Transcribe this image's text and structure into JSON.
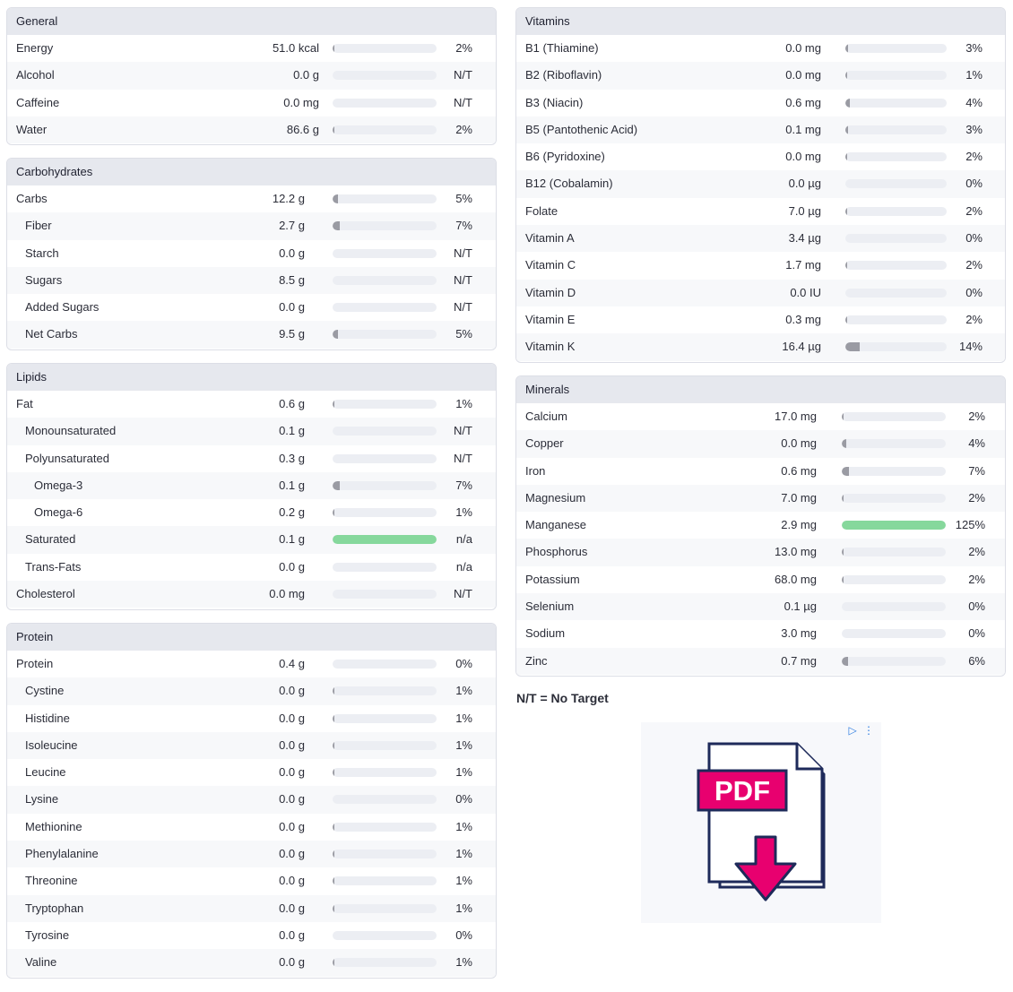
{
  "general": {
    "title": "General",
    "rows": [
      {
        "name": "Energy",
        "amount": "51.0 kcal",
        "pct": "2%",
        "fill": 0.02,
        "indent": 0
      },
      {
        "name": "Alcohol",
        "amount": "0.0 g",
        "pct": "N/T",
        "fill": 0,
        "indent": 0
      },
      {
        "name": "Caffeine",
        "amount": "0.0 mg",
        "pct": "N/T",
        "fill": 0,
        "indent": 0
      },
      {
        "name": "Water",
        "amount": "86.6 g",
        "pct": "2%",
        "fill": 0.02,
        "indent": 0
      }
    ]
  },
  "carbohydrates": {
    "title": "Carbohydrates",
    "rows": [
      {
        "name": "Carbs",
        "amount": "12.2 g",
        "pct": "5%",
        "fill": 0.05,
        "indent": 0
      },
      {
        "name": "Fiber",
        "amount": "2.7 g",
        "pct": "7%",
        "fill": 0.07,
        "indent": 1
      },
      {
        "name": "Starch",
        "amount": "0.0 g",
        "pct": "N/T",
        "fill": 0,
        "indent": 1
      },
      {
        "name": "Sugars",
        "amount": "8.5 g",
        "pct": "N/T",
        "fill": 0,
        "indent": 1
      },
      {
        "name": "Added Sugars",
        "amount": "0.0 g",
        "pct": "N/T",
        "fill": 0,
        "indent": 1
      },
      {
        "name": "Net Carbs",
        "amount": "9.5 g",
        "pct": "5%",
        "fill": 0.05,
        "indent": 1
      }
    ]
  },
  "lipids": {
    "title": "Lipids",
    "rows": [
      {
        "name": "Fat",
        "amount": "0.6 g",
        "pct": "1%",
        "fill": 0.01,
        "indent": 0
      },
      {
        "name": "Monounsaturated",
        "amount": "0.1 g",
        "pct": "N/T",
        "fill": 0,
        "indent": 1
      },
      {
        "name": "Polyunsaturated",
        "amount": "0.3 g",
        "pct": "N/T",
        "fill": 0,
        "indent": 1
      },
      {
        "name": "Omega-3",
        "amount": "0.1 g",
        "pct": "7%",
        "fill": 0.07,
        "indent": 2
      },
      {
        "name": "Omega-6",
        "amount": "0.2 g",
        "pct": "1%",
        "fill": 0.01,
        "indent": 2
      },
      {
        "name": "Saturated",
        "amount": "0.1 g",
        "pct": "n/a",
        "fill": 1,
        "indent": 1
      },
      {
        "name": "Trans-Fats",
        "amount": "0.0 g",
        "pct": "n/a",
        "fill": 0,
        "indent": 1
      },
      {
        "name": "Cholesterol",
        "amount": "0.0 mg",
        "pct": "N/T",
        "fill": 0,
        "indent": 0
      }
    ]
  },
  "protein": {
    "title": "Protein",
    "rows": [
      {
        "name": "Protein",
        "amount": "0.4 g",
        "pct": "0%",
        "fill": 0,
        "indent": 0
      },
      {
        "name": "Cystine",
        "amount": "0.0 g",
        "pct": "1%",
        "fill": 0.01,
        "indent": 1
      },
      {
        "name": "Histidine",
        "amount": "0.0 g",
        "pct": "1%",
        "fill": 0.01,
        "indent": 1
      },
      {
        "name": "Isoleucine",
        "amount": "0.0 g",
        "pct": "1%",
        "fill": 0.01,
        "indent": 1
      },
      {
        "name": "Leucine",
        "amount": "0.0 g",
        "pct": "1%",
        "fill": 0.01,
        "indent": 1
      },
      {
        "name": "Lysine",
        "amount": "0.0 g",
        "pct": "0%",
        "fill": 0,
        "indent": 1
      },
      {
        "name": "Methionine",
        "amount": "0.0 g",
        "pct": "1%",
        "fill": 0.01,
        "indent": 1
      },
      {
        "name": "Phenylalanine",
        "amount": "0.0 g",
        "pct": "1%",
        "fill": 0.01,
        "indent": 1
      },
      {
        "name": "Threonine",
        "amount": "0.0 g",
        "pct": "1%",
        "fill": 0.01,
        "indent": 1
      },
      {
        "name": "Tryptophan",
        "amount": "0.0 g",
        "pct": "1%",
        "fill": 0.01,
        "indent": 1
      },
      {
        "name": "Tyrosine",
        "amount": "0.0 g",
        "pct": "0%",
        "fill": 0,
        "indent": 1
      },
      {
        "name": "Valine",
        "amount": "0.0 g",
        "pct": "1%",
        "fill": 0.01,
        "indent": 1
      }
    ]
  },
  "vitamins": {
    "title": "Vitamins",
    "rows": [
      {
        "name": "B1 (Thiamine)",
        "amount": "0.0 mg",
        "pct": "3%",
        "fill": 0.03,
        "indent": 0
      },
      {
        "name": "B2 (Riboflavin)",
        "amount": "0.0 mg",
        "pct": "1%",
        "fill": 0.01,
        "indent": 0
      },
      {
        "name": "B3 (Niacin)",
        "amount": "0.6 mg",
        "pct": "4%",
        "fill": 0.04,
        "indent": 0
      },
      {
        "name": "B5 (Pantothenic Acid)",
        "amount": "0.1 mg",
        "pct": "3%",
        "fill": 0.03,
        "indent": 0
      },
      {
        "name": "B6 (Pyridoxine)",
        "amount": "0.0 mg",
        "pct": "2%",
        "fill": 0.02,
        "indent": 0
      },
      {
        "name": "B12 (Cobalamin)",
        "amount": "0.0 µg",
        "pct": "0%",
        "fill": 0,
        "indent": 0
      },
      {
        "name": "Folate",
        "amount": "7.0 µg",
        "pct": "2%",
        "fill": 0.02,
        "indent": 0
      },
      {
        "name": "Vitamin A",
        "amount": "3.4 µg",
        "pct": "0%",
        "fill": 0,
        "indent": 0
      },
      {
        "name": "Vitamin C",
        "amount": "1.7 mg",
        "pct": "2%",
        "fill": 0.02,
        "indent": 0
      },
      {
        "name": "Vitamin D",
        "amount": "0.0 IU",
        "pct": "0%",
        "fill": 0,
        "indent": 0
      },
      {
        "name": "Vitamin E",
        "amount": "0.3 mg",
        "pct": "2%",
        "fill": 0.02,
        "indent": 0
      },
      {
        "name": "Vitamin K",
        "amount": "16.4 µg",
        "pct": "14%",
        "fill": 0.14,
        "indent": 0
      }
    ]
  },
  "minerals": {
    "title": "Minerals",
    "rows": [
      {
        "name": "Calcium",
        "amount": "17.0 mg",
        "pct": "2%",
        "fill": 0.02,
        "indent": 0
      },
      {
        "name": "Copper",
        "amount": "0.0 mg",
        "pct": "4%",
        "fill": 0.04,
        "indent": 0
      },
      {
        "name": "Iron",
        "amount": "0.6 mg",
        "pct": "7%",
        "fill": 0.07,
        "indent": 0
      },
      {
        "name": "Magnesium",
        "amount": "7.0 mg",
        "pct": "2%",
        "fill": 0.02,
        "indent": 0
      },
      {
        "name": "Manganese",
        "amount": "2.9 mg",
        "pct": "125%",
        "fill": 1,
        "indent": 0
      },
      {
        "name": "Phosphorus",
        "amount": "13.0 mg",
        "pct": "2%",
        "fill": 0.02,
        "indent": 0
      },
      {
        "name": "Potassium",
        "amount": "68.0 mg",
        "pct": "2%",
        "fill": 0.02,
        "indent": 0
      },
      {
        "name": "Selenium",
        "amount": "0.1 µg",
        "pct": "0%",
        "fill": 0,
        "indent": 0
      },
      {
        "name": "Sodium",
        "amount": "3.0 mg",
        "pct": "0%",
        "fill": 0,
        "indent": 0
      },
      {
        "name": "Zinc",
        "amount": "0.7 mg",
        "pct": "6%",
        "fill": 0.06,
        "indent": 0
      }
    ]
  },
  "legend": {
    "note": "N/T = No Target"
  },
  "ad": {
    "pdf_label": "PDF",
    "choice_icon": "ad-choices-icon"
  },
  "colors": {
    "bar_track": "#eceef3",
    "bar_fill": "#9a9ba3",
    "bar_full": "#86d89c",
    "ad_pink": "#e8006f",
    "ad_navy": "#1e2a5a"
  }
}
